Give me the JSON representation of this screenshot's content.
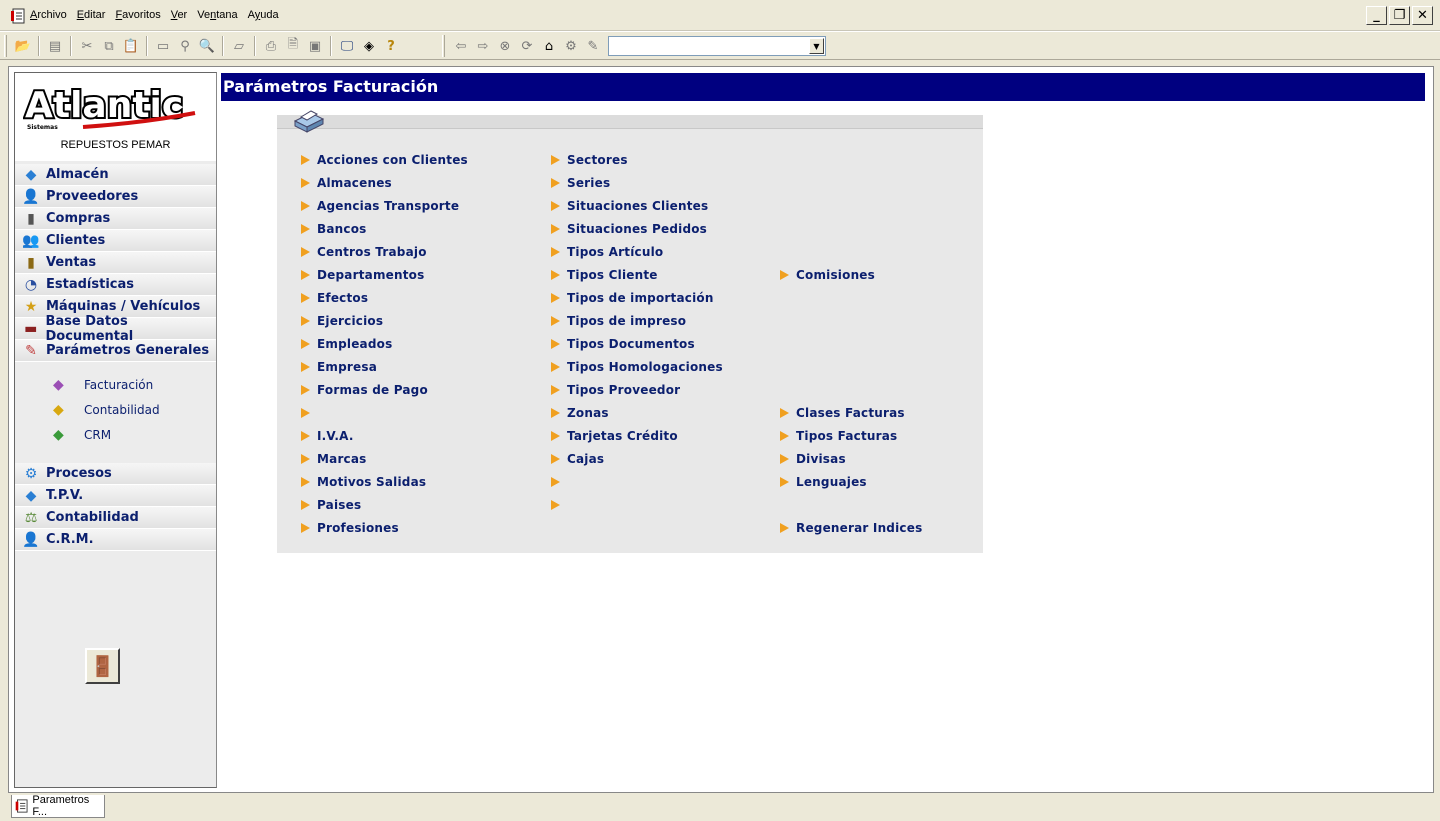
{
  "menubar": {
    "items": [
      {
        "label": "Archivo",
        "accel": "A"
      },
      {
        "label": "Editar",
        "accel": "E"
      },
      {
        "label": "Favoritos",
        "accel": "F"
      },
      {
        "label": "Ver",
        "accel": "V"
      },
      {
        "label": "Ventana",
        "accel": "n"
      },
      {
        "label": "Ayuda",
        "accel": "y"
      }
    ],
    "window_buttons": {
      "minimize": "_",
      "restore": "❐",
      "close": "✕"
    }
  },
  "toolbar": {
    "combo_value": ""
  },
  "sidebar": {
    "logo_text": "Atlantic",
    "logo_subtext": "Sistemas",
    "company": "REPUESTOS PEMAR",
    "nav_items": [
      {
        "label": "Almacén",
        "icon": "boxes-icon"
      },
      {
        "label": "Proveedores",
        "icon": "supplier-icon"
      },
      {
        "label": "Compras",
        "icon": "purchases-icon"
      },
      {
        "label": "Clientes",
        "icon": "clients-icon"
      },
      {
        "label": "Ventas",
        "icon": "sales-icon"
      },
      {
        "label": "Estadísticas",
        "icon": "stats-icon"
      },
      {
        "label": "Máquinas / Vehículos",
        "icon": "machines-icon"
      },
      {
        "label": "Base Datos Documental",
        "icon": "documents-icon"
      },
      {
        "label": "Parámetros Generales",
        "icon": "params-icon"
      }
    ],
    "sub_items": [
      {
        "label": "Facturación",
        "icon": "book-purple-icon",
        "color": "#9b4fb5"
      },
      {
        "label": "Contabilidad",
        "icon": "book-yellow-icon",
        "color": "#d8a810"
      },
      {
        "label": "CRM",
        "icon": "book-green-icon",
        "color": "#3a9a3a"
      }
    ],
    "nav_items_2": [
      {
        "label": "Procesos",
        "icon": "gears-icon"
      },
      {
        "label": "T.P.V.",
        "icon": "pos-icon"
      },
      {
        "label": "Contabilidad",
        "icon": "accounting-icon"
      },
      {
        "label": "C.R.M.",
        "icon": "crm-icon"
      }
    ]
  },
  "main": {
    "title": "Parámetros Facturación",
    "columns": [
      [
        "Acciones con Clientes",
        "Almacenes",
        "Agencias Transporte",
        "Bancos",
        "Centros Trabajo",
        "Departamentos",
        "Efectos",
        "Ejercicios",
        "Empleados",
        "Empresa",
        "Formas de Pago",
        "",
        "I.V.A.",
        "Marcas",
        "Motivos Salidas",
        "Paises",
        "Profesiones"
      ],
      [
        "Sectores",
        "Series",
        "Situaciones Clientes",
        "Situaciones Pedidos",
        "Tipos Artículo",
        "Tipos Cliente",
        "Tipos de importación",
        "Tipos de impreso",
        "Tipos Documentos",
        "Tipos Homologaciones",
        "Tipos Proveedor",
        "Zonas",
        "Tarjetas Crédito",
        "Cajas",
        "",
        ""
      ],
      [
        null,
        null,
        null,
        null,
        null,
        "Comisiones",
        null,
        null,
        null,
        null,
        null,
        "Clases Facturas",
        "Tipos Facturas",
        "Divisas",
        "Lenguajes",
        null,
        "Regenerar Indices"
      ]
    ]
  },
  "taskbar": {
    "tab_label": "Parametros F..."
  },
  "colors": {
    "title_bg": "#000080",
    "link_text": "#0b1f6e",
    "bullet": "#f0a020"
  }
}
